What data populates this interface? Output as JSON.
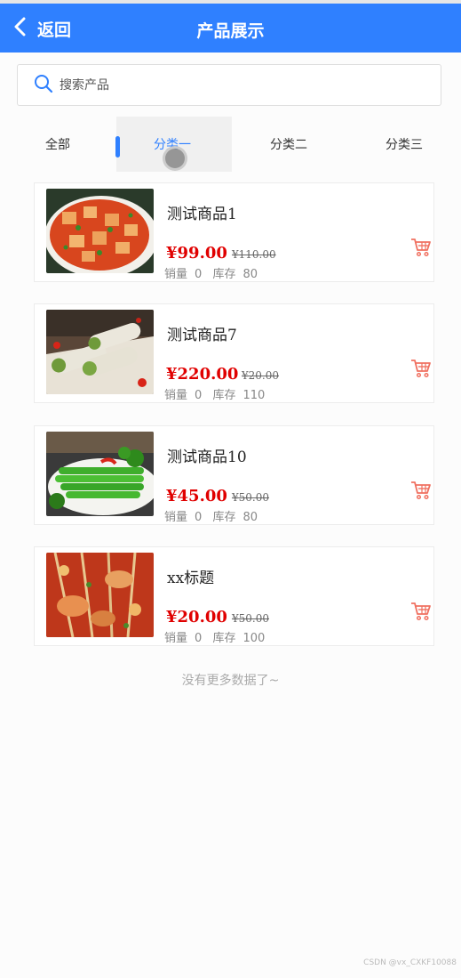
{
  "navbar": {
    "back_label": "返回",
    "title": "产品展示",
    "color": "#2f80ff"
  },
  "search": {
    "placeholder": "搜索产品"
  },
  "tabs": [
    {
      "label": "全部",
      "active": false
    },
    {
      "label": "分类一",
      "active": true
    },
    {
      "label": "分类二",
      "active": false
    },
    {
      "label": "分类三",
      "active": false
    }
  ],
  "products": [
    {
      "name": "测试商品1",
      "price": "¥99.00",
      "original_price": "¥110.00",
      "sales_label": "销量",
      "sales": "0",
      "stock_label": "库存",
      "stock": "80",
      "image": "mapo-tofu"
    },
    {
      "name": "测试商品7",
      "price": "¥220.00",
      "original_price": "¥20.00",
      "sales_label": "销量",
      "sales": "0",
      "stock_label": "库存",
      "stock": "110",
      "image": "rolls"
    },
    {
      "name": "测试商品10",
      "price": "¥45.00",
      "original_price": "¥50.00",
      "sales_label": "销量",
      "sales": "0",
      "stock_label": "库存",
      "stock": "80",
      "image": "greens"
    },
    {
      "name": "xx标题",
      "price": "¥20.00",
      "original_price": "¥50.00",
      "sales_label": "销量",
      "sales": "0",
      "stock_label": "库存",
      "stock": "100",
      "image": "skewers"
    }
  ],
  "footer": {
    "no_more": "没有更多数据了~"
  },
  "watermark": "CSDN @vx_CXKF10088",
  "colors": {
    "price": "#e00000",
    "cart": "#f07060"
  }
}
